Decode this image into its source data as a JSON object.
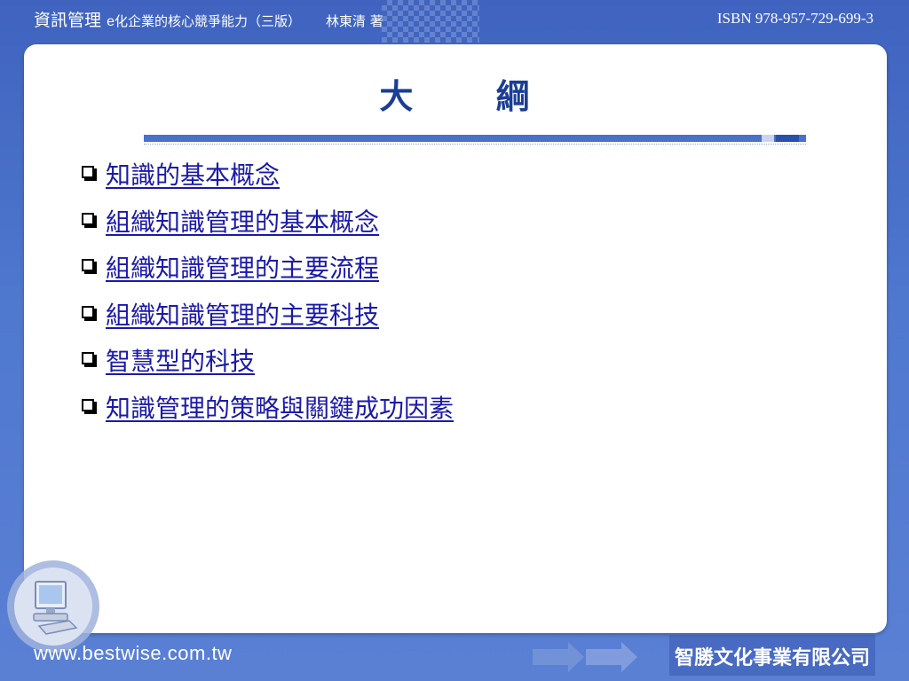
{
  "header": {
    "course_title": "資訊管理",
    "book_prefix": "e",
    "book_title": "化企業的核心競爭能力（三版）",
    "author": "林東清 著",
    "isbn": "ISBN 978-957-729-699-3"
  },
  "slide": {
    "title": "大 綱",
    "items": [
      {
        "label": "知識的基本概念"
      },
      {
        "label": "組織知識管理的基本概念"
      },
      {
        "label": "組織知識管理的主要流程"
      },
      {
        "label": "組織知識管理的主要科技"
      },
      {
        "label": "智慧型的科技"
      },
      {
        "label": "知識管理的策略與關鍵成功因素"
      }
    ]
  },
  "footer": {
    "website": "www.bestwise.com.tw",
    "publisher": "智勝文化事業有限公司"
  },
  "colors": {
    "background": "#4a70c8",
    "title": "#1a3e96",
    "link": "#1a1aa8",
    "panel": "#ffffff"
  },
  "icons": [
    "computer-icon",
    "arrow-icon",
    "checkbox-bullet-icon"
  ]
}
